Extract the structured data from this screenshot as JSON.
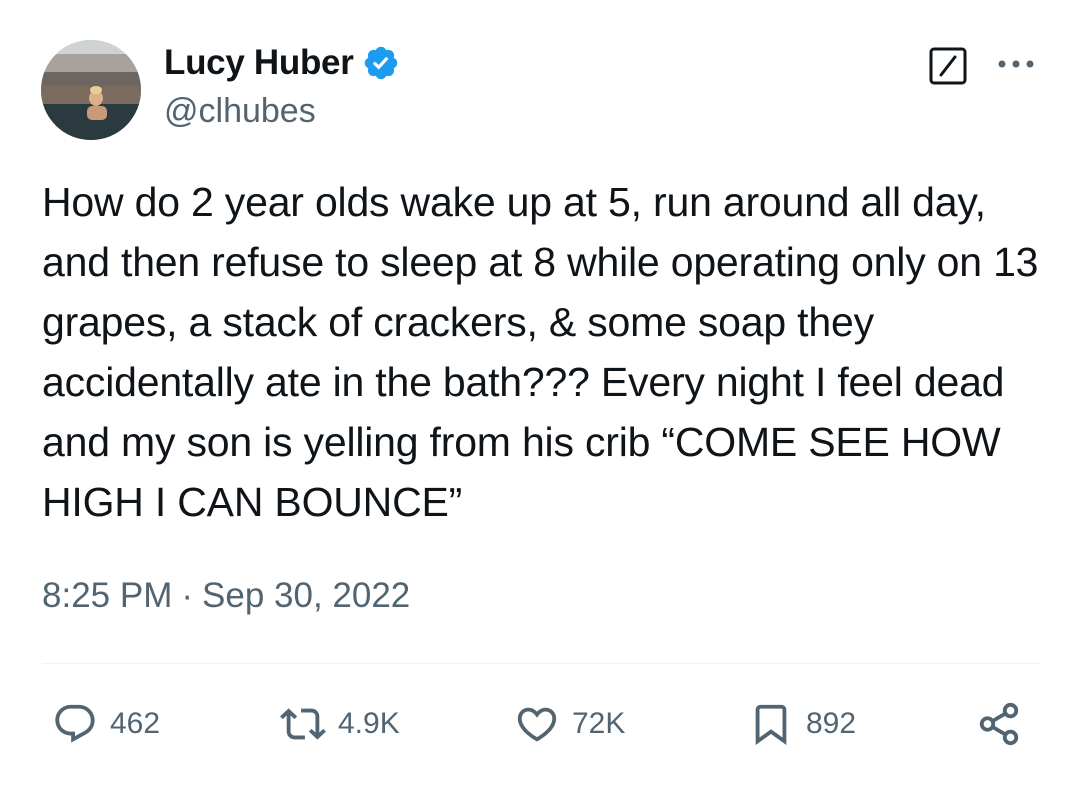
{
  "author": {
    "display_name": "Lucy Huber",
    "handle": "@clhubes",
    "verified": true,
    "avatar_icon": "profile-photo"
  },
  "header_actions": {
    "grok_icon": "grok-icon",
    "more_icon": "more-icon"
  },
  "tweet": {
    "text": "How do 2 year olds wake up at 5, run around all day, and then refuse to sleep at 8 while operating only on 13 grapes, a stack of crackers, & some soap they accidentally ate in the bath??? Every night I feel dead and my son is yelling from his crib “COME SEE HOW HIGH I CAN BOUNCE”",
    "time": "8:25 PM",
    "separator": "·",
    "date": "Sep 30, 2022"
  },
  "actions": {
    "replies": "462",
    "reposts": "4.9K",
    "likes": "72K",
    "bookmarks": "892"
  },
  "colors": {
    "text": "#0f1419",
    "secondary": "#536471",
    "verified_blue": "#1d9bf0",
    "divider": "#eff3f4"
  }
}
